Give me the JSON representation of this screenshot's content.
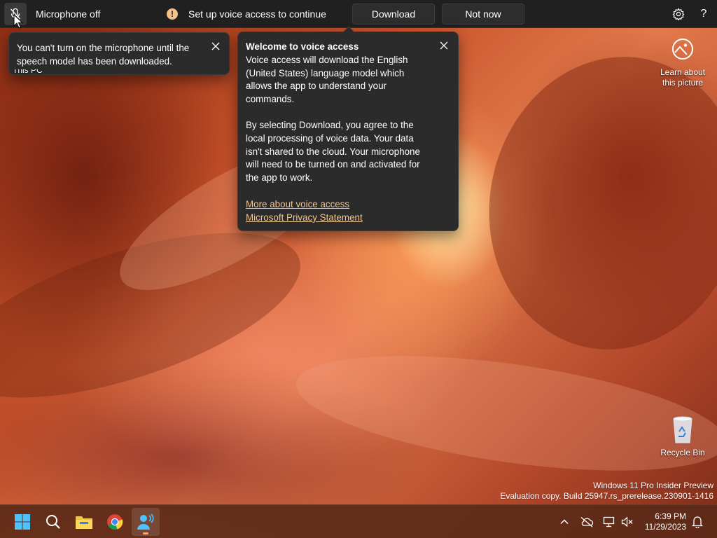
{
  "voice_bar": {
    "mic_status": "Microphone off",
    "setup_message": "Set up voice access to continue",
    "download_label": "Download",
    "not_now_label": "Not now"
  },
  "mic_flyout": {
    "text": "You can't turn on the microphone until the speech model has been downloaded."
  },
  "welcome_flyout": {
    "title": "Welcome to voice access",
    "paragraph1": "Voice access will download the English (United States) language model which allows the app to understand your commands.",
    "paragraph2": "By selecting Download, you agree to the local processing of voice data. Your data isn't shared to the cloud. Your microphone will need to be turned on and activated for the app to work.",
    "link1": "More about voice access",
    "link2": "Microsoft Privacy Statement"
  },
  "desktop": {
    "this_pc_label": "This PC",
    "learn_picture_label": "Learn about this picture",
    "recycle_bin_label": "Recycle Bin",
    "watermark_line1": "Windows 11 Pro Insider Preview",
    "watermark_line2": "Evaluation copy. Build 25947.rs_prerelease.230901-1416"
  },
  "taskbar": {
    "apps": [
      "windows-start-icon",
      "search-icon",
      "file-explorer-icon",
      "chrome-icon",
      "voice-access-icon"
    ],
    "time": "6:39 PM",
    "date": "11/29/2023"
  },
  "colors": {
    "bar_bg": "#202020",
    "flyout_bg": "#2b2b2b",
    "link": "#f0c48f",
    "warn": "#f2c28a"
  }
}
